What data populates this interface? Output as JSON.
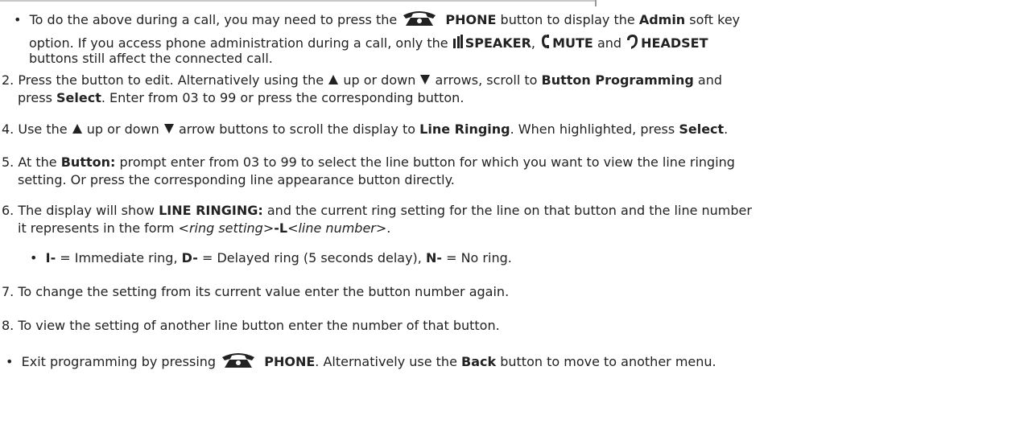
{
  "bullet_a": {
    "t1": "To do the above during a call, you may need to press the",
    "phone_label": "PHONE",
    "t2": "button to display the",
    "admin": "Admin",
    "t3": "soft key",
    "t4": "option. If you access phone administration during a call, only the",
    "speaker": "SPEAKER",
    "t5": ",",
    "mute": "MUTE",
    "t6": "and",
    "headset": "HEADSET",
    "t7": "buttons still affect the connected call."
  },
  "step2": {
    "num": "2.",
    "t1": "Press the button to edit. Alternatively using the",
    "t2": "up or down",
    "t3": "arrows, scroll to",
    "bp": "Button Programming",
    "t4": "and",
    "t5": "press",
    "select": "Select",
    "t6": ". Enter from 03 to 99 or press the corresponding button."
  },
  "step4": {
    "num": "4.",
    "t1": "Use the",
    "t2": "up or down",
    "t3": "arrow buttons to scroll the display to",
    "lr": "Line Ringing",
    "t4": ". When highlighted, press",
    "select": "Select",
    "t5": "."
  },
  "step5": {
    "num": "5.",
    "t1": "At the",
    "button": "Button:",
    "t2": "prompt enter from 03 to 99 to select the line button for which you want to view the line ringing",
    "t3": "setting.  Or press the corresponding line appearance button directly."
  },
  "step6": {
    "num": "6.",
    "t1": "The display will show",
    "lr": "LINE RINGING:",
    "t2": "and the current ring setting for the line on that button and the line number",
    "t3": "it represents in the form",
    "ring": "<ring setting>",
    "dashL": "-L",
    "line": "<line number>",
    "t4": "."
  },
  "bullet_b": {
    "i": "I-",
    "t1": "= Immediate ring,",
    "d": "D-",
    "t2": "= Delayed ring (5 seconds delay),",
    "n": "N-",
    "t3": "= No ring."
  },
  "step7": {
    "num": "7.",
    "t1": "To change the setting from its current value enter the button number again."
  },
  "step8": {
    "num": "8.",
    "t1": "To view the setting of another line button enter the number of that button."
  },
  "bullet_c": {
    "t1": "Exit programming by pressing",
    "phone_label": "PHONE",
    "t2": ". Alternatively use the",
    "back": "Back",
    "t3": "button to move to another menu."
  },
  "colors": {
    "text": "#222222",
    "icon": "#222222",
    "rule": "#c8c8c8"
  }
}
